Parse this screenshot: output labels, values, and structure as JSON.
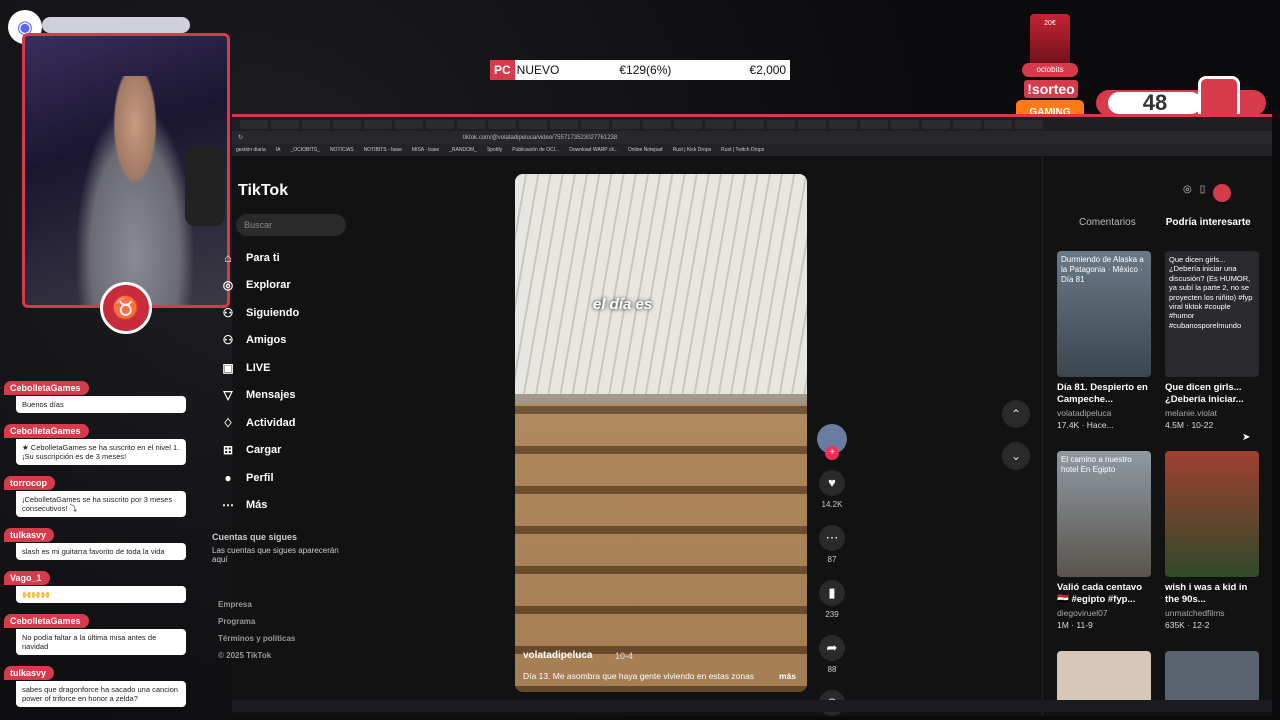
{
  "overlay": {
    "ticker": {
      "tag": "PC",
      "label": "NUEVO",
      "price": "€129(6%)",
      "total": "€2,000"
    },
    "sorteo": "!sorteo",
    "ociobits": "ociobits",
    "gaming": "GAMING",
    "counter": "48",
    "card_text": "20€"
  },
  "chat": [
    {
      "user": "CebolletaGames",
      "text": "Buenos días"
    },
    {
      "user": "CebolletaGames",
      "text": "★ CebolletaGames se ha suscrito en el nivel 1. ¡Su suscripción es de 3 meses!"
    },
    {
      "user": "torrocop",
      "text": "¡CebolletaGames se ha suscrito por 3 meses consecutivos! ⤵"
    },
    {
      "user": "tulkasvy",
      "text": "slash es mi guitarra favorito de toda la vida"
    },
    {
      "user": "Vago_1",
      "text": "🙌🙌🙌"
    },
    {
      "user": "CebolletaGames",
      "text": "No podía faltar a la última misa antes de navidad"
    },
    {
      "user": "tulkasvy",
      "text": "sabes que dragonforce ha sacado una cancion power of triforce en honor a zelda?"
    }
  ],
  "browser": {
    "url": "tiktok.com/@volatadipeluca/video/7557173523027761238",
    "bookmarks": [
      "gestión diaria",
      "IA",
      "_OCIOBITS_",
      "NOTICIAS",
      "NOTIBITS - base",
      "MISA - base",
      "_RANDOM_",
      "Spotify",
      "Publicación de OCI...",
      "Download WARP cli...",
      "Online Notepad",
      "Rust | Kick Drops",
      "Rust | Twitch Drops"
    ]
  },
  "tiktok": {
    "logo": "TikTok",
    "search_placeholder": "Buscar",
    "nav": [
      {
        "label": "Para ti",
        "icon": "home-icon",
        "glyph": "⌂"
      },
      {
        "label": "Explorar",
        "icon": "compass-icon",
        "glyph": "◎"
      },
      {
        "label": "Siguiendo",
        "icon": "following-icon",
        "glyph": "⚇"
      },
      {
        "label": "Amigos",
        "icon": "friends-icon",
        "glyph": "⚇"
      },
      {
        "label": "LIVE",
        "icon": "live-icon",
        "glyph": "▣"
      },
      {
        "label": "Mensajes",
        "icon": "messages-icon",
        "glyph": "▽"
      },
      {
        "label": "Actividad",
        "icon": "activity-icon",
        "glyph": "♢"
      },
      {
        "label": "Cargar",
        "icon": "upload-icon",
        "glyph": "⊞"
      },
      {
        "label": "Perfil",
        "icon": "profile-icon",
        "glyph": "●"
      },
      {
        "label": "Más",
        "icon": "more-icon",
        "glyph": "⋯"
      }
    ],
    "following_heading": "Cuentas que sigues",
    "following_text": "Las cuentas que sigues aparecerán aquí",
    "footer": [
      "Empresa",
      "Programa",
      "Términos y políticas",
      "© 2025 TikTok"
    ],
    "video": {
      "caption": "el día es",
      "author": "volatadipeluca",
      "date": "10-4",
      "description": "Día 13. Me asombra que haya gente viviendo en estas zonas",
      "more": "más"
    },
    "actions": {
      "likes": "14.2K",
      "comments": "87",
      "saves": "239",
      "shares": "88"
    },
    "right_panel": {
      "tabs": [
        "Comentarios",
        "Podría interesarte"
      ],
      "cards": [
        {
          "thumb_text": "Durmiendo de Alaska a la Patagonia · México · Día 81",
          "title": "Día 81. Despierto en Campeche...",
          "user": "volatadipeluca",
          "stat": "17.4K · Hace..."
        },
        {
          "thumb_text": "Que dicen girls... ¿Debería iniciar una discusión? (Es HUMOR, ya subí la parte 2, no se proyecten los niñito) #fyp viral tiktok #couple #humor #cubanosporelmundo",
          "title": "Que dicen girls... ¿Debería iniciar...",
          "user": "melanie.violat",
          "stat": "4.5M · 10-22"
        },
        {
          "thumb_text": "El camino a nuestro hotel En Egipto",
          "title": "Valió cada centavo 🇪🇬 #egipto #fyp...",
          "user": "diegoviruel07",
          "stat": "1M · 11-9"
        },
        {
          "thumb_text": "",
          "title": "wish i was a kid in the 90s...",
          "user": "unmatchedfilms",
          "stat": "635K · 12-2"
        }
      ]
    }
  }
}
